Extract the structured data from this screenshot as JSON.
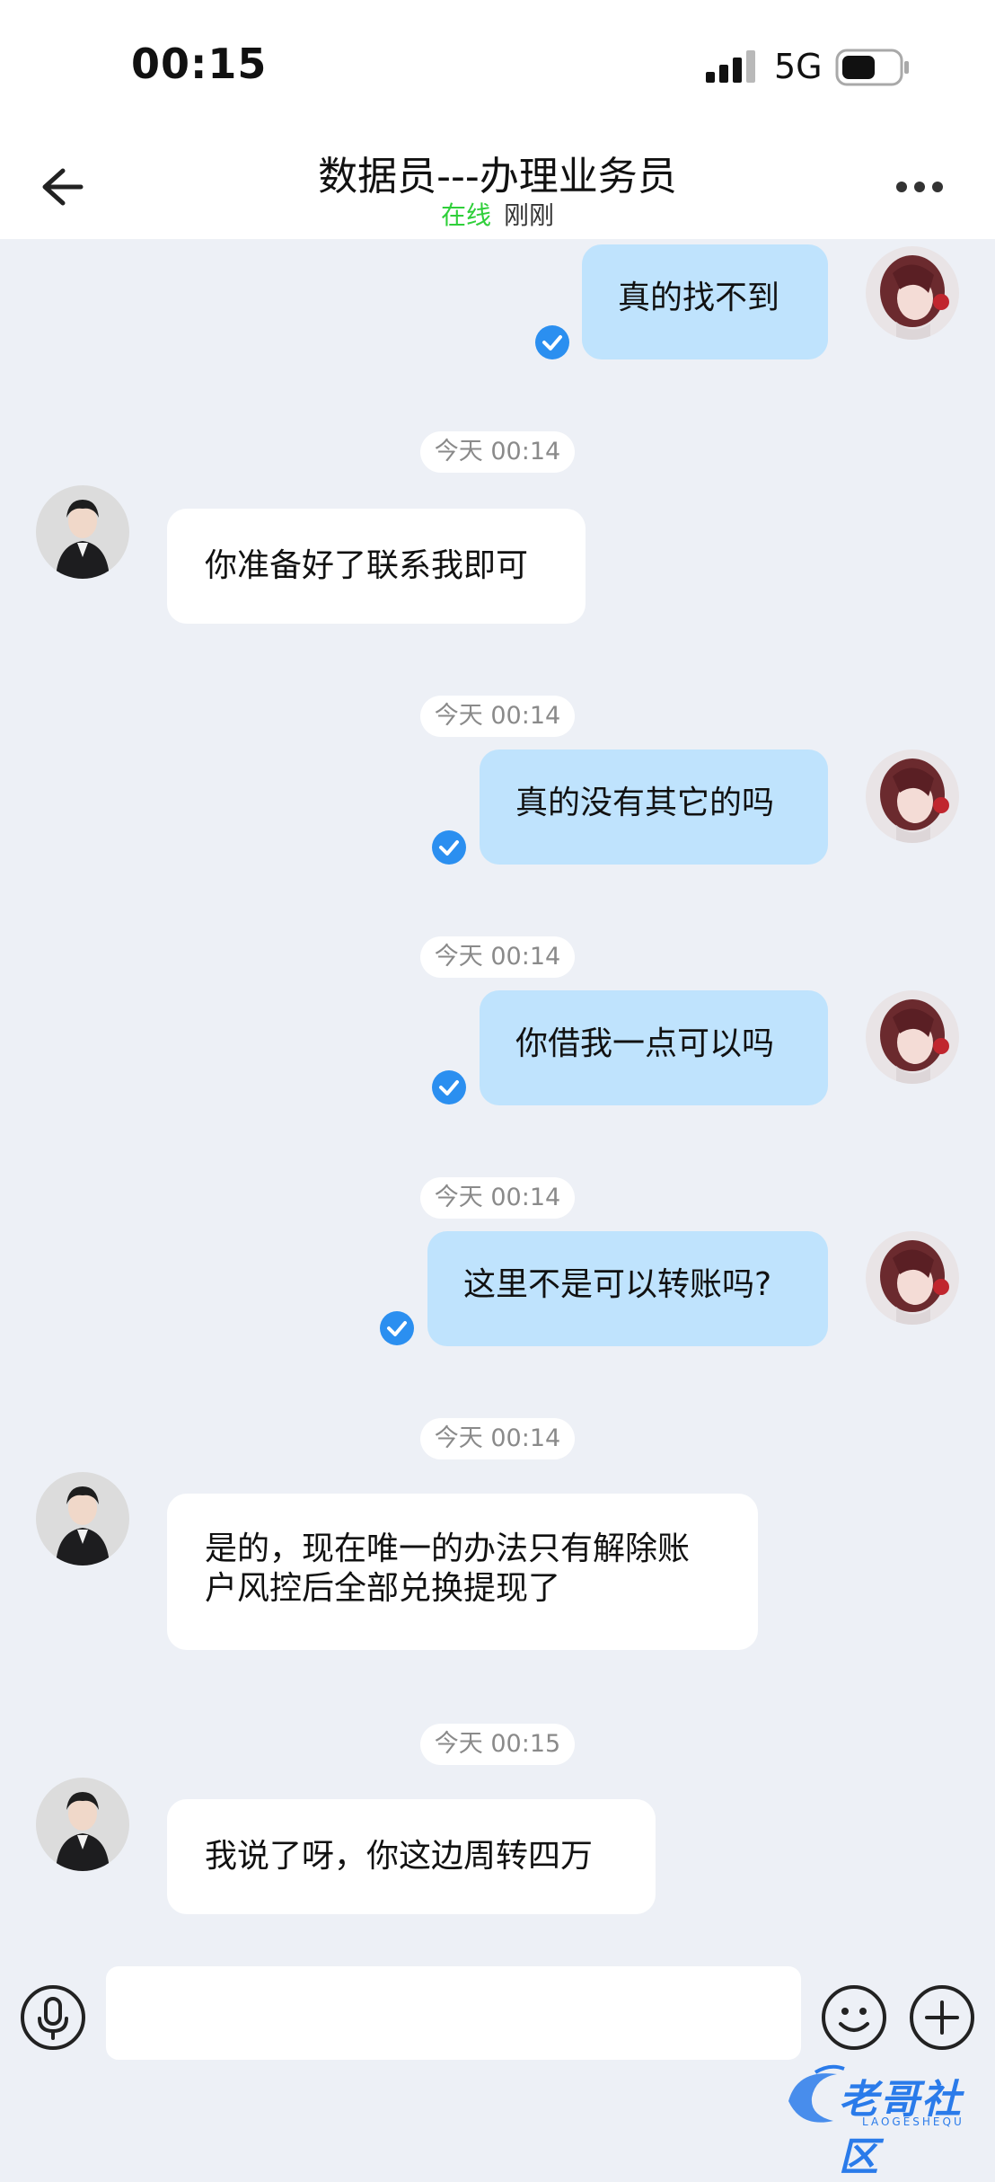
{
  "status": {
    "time": "00:15",
    "network": "5G"
  },
  "header": {
    "title": "数据员---办理业务员",
    "online": "在线",
    "last_seen": "刚刚"
  },
  "messages": [
    {
      "side": "out",
      "text": "真的找不到"
    },
    {
      "stamp": "今天 00:14"
    },
    {
      "side": "in",
      "text": "你准备好了联系我即可"
    },
    {
      "stamp": "今天 00:14"
    },
    {
      "side": "out",
      "text": "真的没有其它的吗"
    },
    {
      "stamp": "今天 00:14"
    },
    {
      "side": "out",
      "text": "你借我一点可以吗"
    },
    {
      "stamp": "今天 00:14"
    },
    {
      "side": "out",
      "text": "这里不是可以转账吗?"
    },
    {
      "stamp": "今天 00:14"
    },
    {
      "side": "in",
      "text": "是的，现在唯一的办法只有解除账户风控后全部兑换提现了",
      "line1": "是的，现在唯一的办法只有解除账",
      "line2": "户风控后全部兑换提现了"
    },
    {
      "stamp": "今天 00:15"
    },
    {
      "side": "in",
      "text": "我说了呀，你这边周转四万"
    }
  ],
  "watermark": {
    "text": "老哥社区",
    "sub": "LAOGESHEQU"
  },
  "colors": {
    "outgoing_bubble": "#bfe3fd",
    "incoming_bubble": "#ffffff",
    "background": "#edf0f6",
    "online": "#2fcf3a",
    "check": "#2b8ff0"
  }
}
